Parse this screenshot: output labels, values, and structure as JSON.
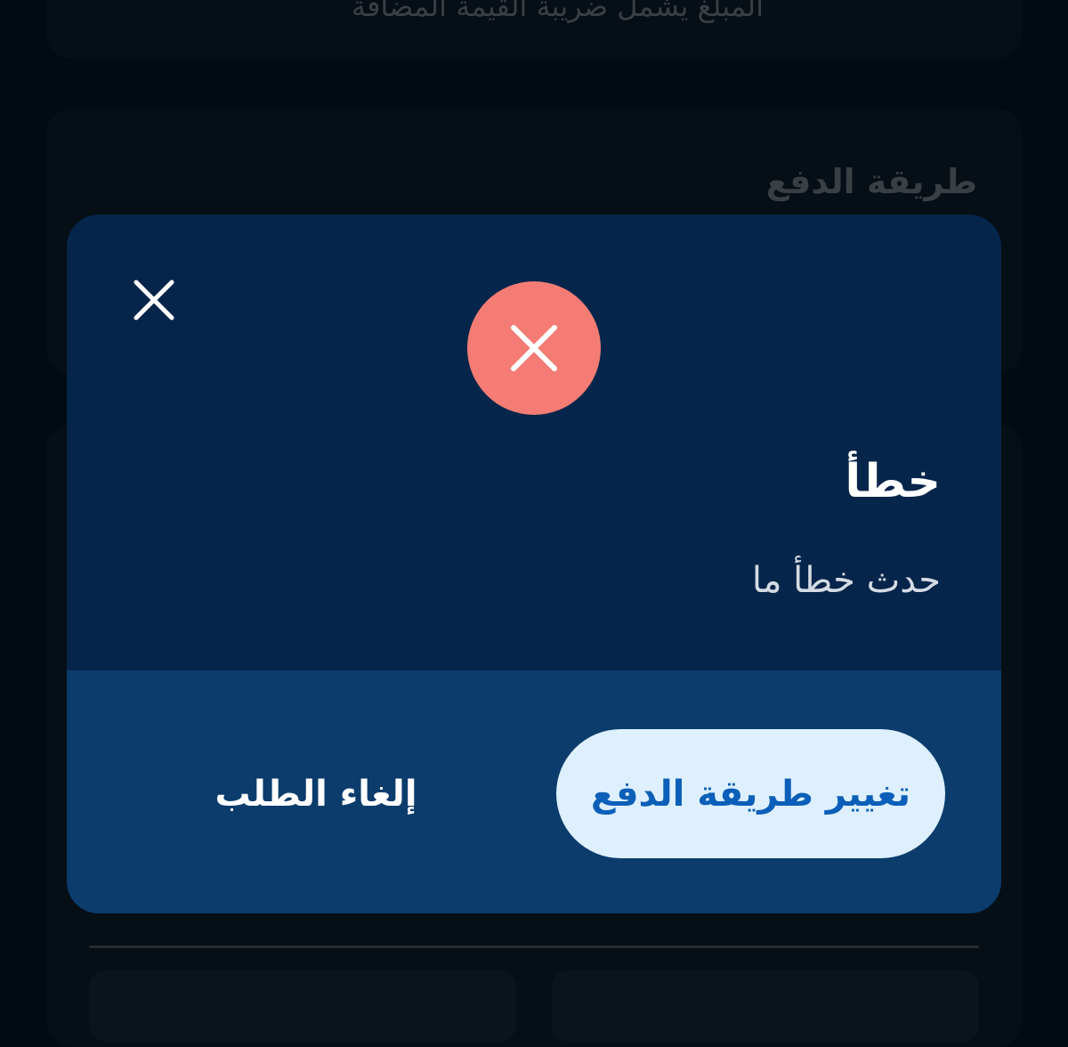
{
  "background": {
    "top_text": "المبلغ يشمل ضريبة القيمة المضافة",
    "section_title": "طريقة الدفع"
  },
  "dialog": {
    "close_icon": "close-icon",
    "status_icon": "error-x-icon",
    "title": "خطأ",
    "message": "حدث خطأ ما",
    "primary_button_label": "تغيير طريقة الدفع",
    "secondary_button_label": "إلغاء الطلب"
  },
  "colors": {
    "dialog_background": "#06254a",
    "footer_background": "#0b3c6c",
    "error_badge": "#f47c74",
    "primary_button_background": "#def0ff",
    "primary_button_text": "#0b5fb8"
  }
}
